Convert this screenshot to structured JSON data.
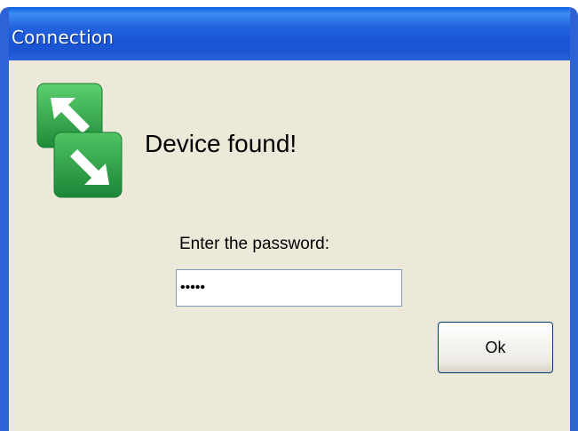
{
  "window": {
    "title": "Connection"
  },
  "dialog": {
    "heading": "Device found!",
    "password_prompt": "Enter the password:",
    "password_value": "12345",
    "ok_label": "Ok"
  },
  "icons": {
    "app_icon": "two-green-squares-diagonal-arrows-icon"
  },
  "colors": {
    "titlebar": "#1b55d3",
    "frame": "#2f62d4",
    "client_background": "#ece9d8",
    "icon_green": "#29a046",
    "input_border": "#7f9db9",
    "button_border": "#003c74"
  }
}
